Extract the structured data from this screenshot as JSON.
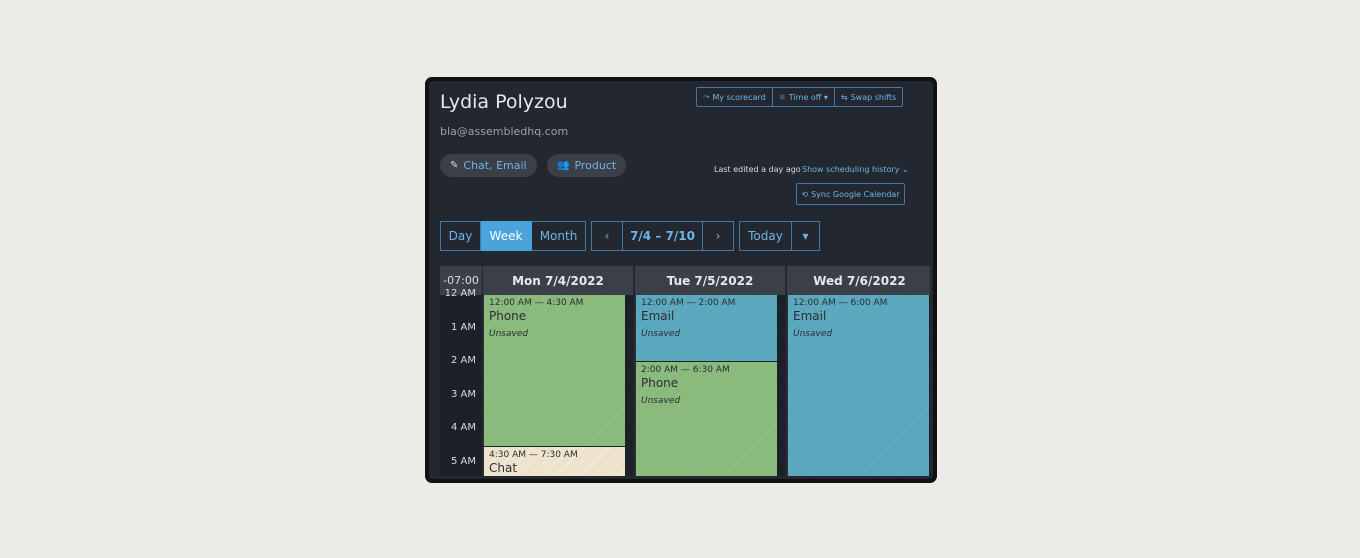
{
  "profile": {
    "name": "Lydia Polyzou",
    "email": "bla@assembledhq.com"
  },
  "top_actions": [
    {
      "label": "My scorecard",
      "icon": "chart-line-icon"
    },
    {
      "label": "Time off ▾",
      "icon": "sun-icon"
    },
    {
      "label": "Swap shifts",
      "icon": "swap-icon"
    }
  ],
  "tags": {
    "channels": {
      "icon": "pencil-icon",
      "label": "Chat, Email"
    },
    "team": {
      "icon": "users-icon",
      "label": "Product"
    }
  },
  "last_edited": "Last edited a day ago",
  "history_link": "Show scheduling history ⌄",
  "sync_button": "Sync Google Calendar",
  "views": [
    "Day",
    "Week",
    "Month"
  ],
  "active_view": "Week",
  "date_nav": {
    "prev": "‹",
    "range": "7/4 – 7/10",
    "next": "›"
  },
  "today_button": "Today",
  "today_dropdown": "▾",
  "calendar": {
    "timezone": "-07:00",
    "hours": [
      "12 AM",
      "1 AM",
      "2 AM",
      "3 AM",
      "4 AM",
      "5 AM"
    ],
    "days": [
      {
        "label": "Mon 7/4/2022",
        "events": [
          {
            "time": "12:00 AM — 4:30 AM",
            "type": "Phone",
            "status": "Unsaved",
            "color": "#89b97b"
          },
          {
            "time": "4:30 AM — 7:30 AM",
            "type": "Chat",
            "status": "",
            "color": "#ede3cd"
          }
        ]
      },
      {
        "label": "Tue 7/5/2022",
        "events": [
          {
            "time": "12:00 AM — 2:00 AM",
            "type": "Email",
            "status": "Unsaved",
            "color": "#5aa7be"
          },
          {
            "time": "2:00 AM — 6:30 AM",
            "type": "Phone",
            "status": "Unsaved",
            "color": "#89b97b"
          }
        ]
      },
      {
        "label": "Wed 7/6/2022",
        "events": [
          {
            "time": "12:00 AM — 6:00 AM",
            "type": "Email",
            "status": "Unsaved",
            "color": "#5aa7be"
          }
        ]
      }
    ]
  }
}
